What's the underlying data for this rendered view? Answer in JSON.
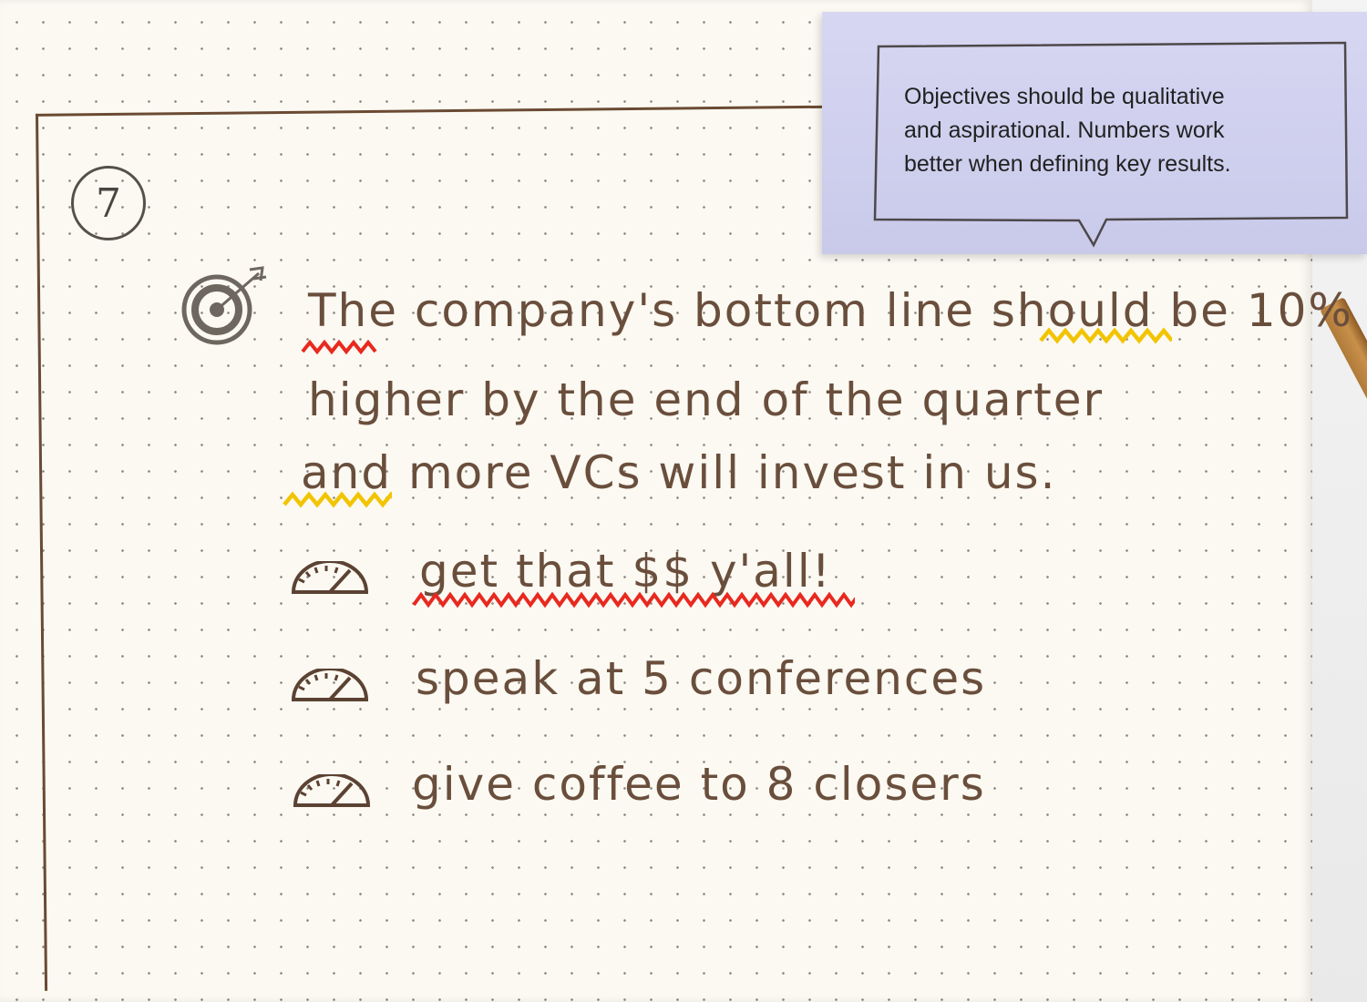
{
  "step_number": "7",
  "note": {
    "lines": [
      "Objectives should be qualitative",
      "and aspirational.  Numbers work",
      "better when defining key results."
    ]
  },
  "objective": {
    "lines": [
      "The company's bottom line should be 10%",
      "higher by the end of the quarter",
      "and more VCs will invest in us."
    ]
  },
  "key_results": [
    "get that $$ y'all!",
    "speak at 5 conferences",
    "give coffee to 8 closers"
  ],
  "colors": {
    "ink": "#6a4e3c",
    "red_squiggle": "#e8291f",
    "yellow_squiggle": "#f2c400",
    "note_bg": "#d3d3f0"
  },
  "icons": [
    "target-icon",
    "gauge-icon"
  ]
}
